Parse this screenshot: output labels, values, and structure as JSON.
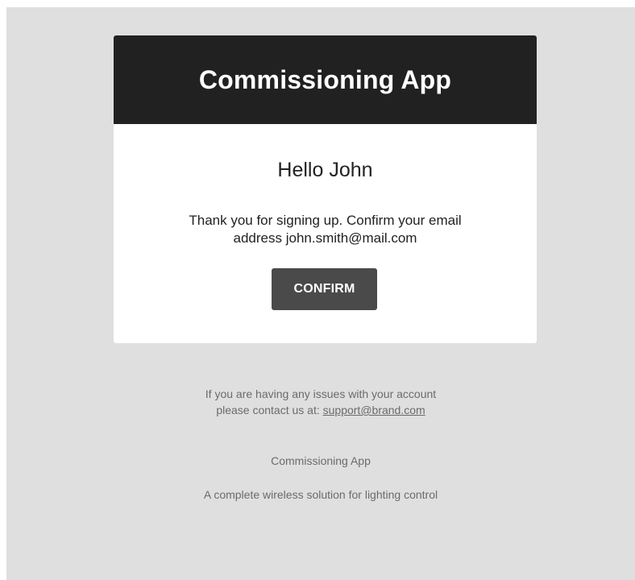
{
  "header": {
    "title": "Commissioning App"
  },
  "body": {
    "greeting": "Hello John",
    "message_line1": "Thank you for signing up. Confirm your email",
    "message_line2": "address john.smith@mail.com",
    "confirm_label": "CONFIRM"
  },
  "footer": {
    "support_line1": "If you are having any issues with your account",
    "support_line2_prefix": "please contact us at: ",
    "support_email": "support@brand.com",
    "app_name": "Commissioning App",
    "tagline": "A complete wireless solution for lighting control"
  },
  "colors": {
    "header_bg": "#212121",
    "button_bg": "#4a4a4a",
    "page_bg": "#dfdfdf"
  }
}
